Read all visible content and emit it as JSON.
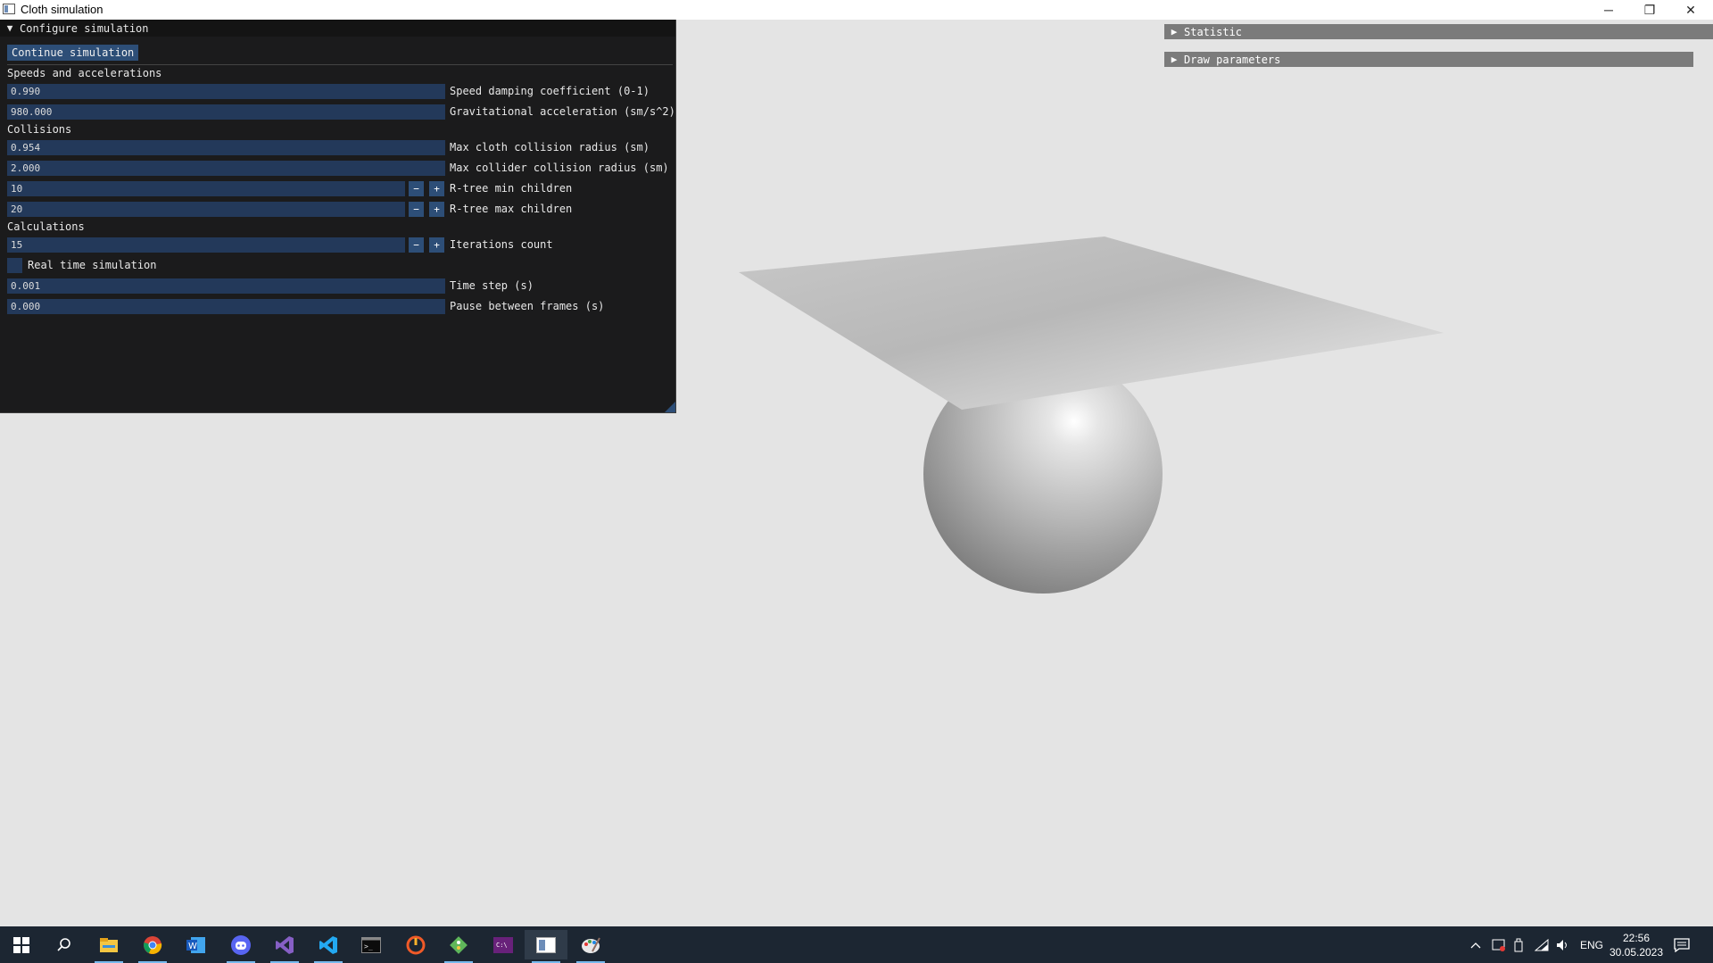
{
  "window": {
    "title": "Cloth simulation",
    "controls": {
      "minimize": "─",
      "maximize": "❐",
      "close": "✕"
    }
  },
  "config_panel": {
    "header": "Configure simulation",
    "continue_button": "Continue simulation",
    "sections": {
      "speeds": "Speeds and accelerations",
      "collisions": "Collisions",
      "calculations": "Calculations"
    },
    "fields": {
      "speed_damping": {
        "value": "0.990",
        "label": "Speed damping coefficient (0-1)"
      },
      "gravity": {
        "value": "980.000",
        "label": "Gravitational acceleration (sm/s^2)"
      },
      "cloth_radius": {
        "value": "0.954",
        "label": "Max cloth collision radius (sm)"
      },
      "collider_radius": {
        "value": "2.000",
        "label": "Max collider collision radius (sm)"
      },
      "rtree_min": {
        "value": "10",
        "label": "R-tree min children"
      },
      "rtree_max": {
        "value": "20",
        "label": "R-tree max children"
      },
      "iterations": {
        "value": "15",
        "label": "Iterations count"
      },
      "real_time": {
        "label": "Real time simulation",
        "checked": false
      },
      "time_step": {
        "value": "0.001",
        "label": "Time step (s)"
      },
      "pause": {
        "value": "0.000",
        "label": "Pause between frames (s)"
      }
    },
    "stepper": {
      "minus": "−",
      "plus": "+"
    }
  },
  "right_panels": {
    "statistic": "Statistic",
    "draw_parameters": "Draw parameters"
  },
  "taskbar": {
    "apps": [
      "windows-start",
      "search",
      "file-explorer",
      "chrome",
      "word",
      "discord",
      "visual-studio",
      "vscode",
      "terminal",
      "profiler",
      "git-client",
      "visual-studio-preview",
      "cloth-simulation",
      "paint"
    ],
    "tray": {
      "language": "ENG",
      "time": "22:56",
      "date": "30.05.2023"
    }
  },
  "colors": {
    "scene_bg": "#e4e4e4",
    "panel_bg": "#1b1b1c",
    "field_bg": "#23395a",
    "button_bg": "#2d4e77",
    "right_panel_bg": "#7b7b7b",
    "taskbar_bg": "#1c2632"
  }
}
